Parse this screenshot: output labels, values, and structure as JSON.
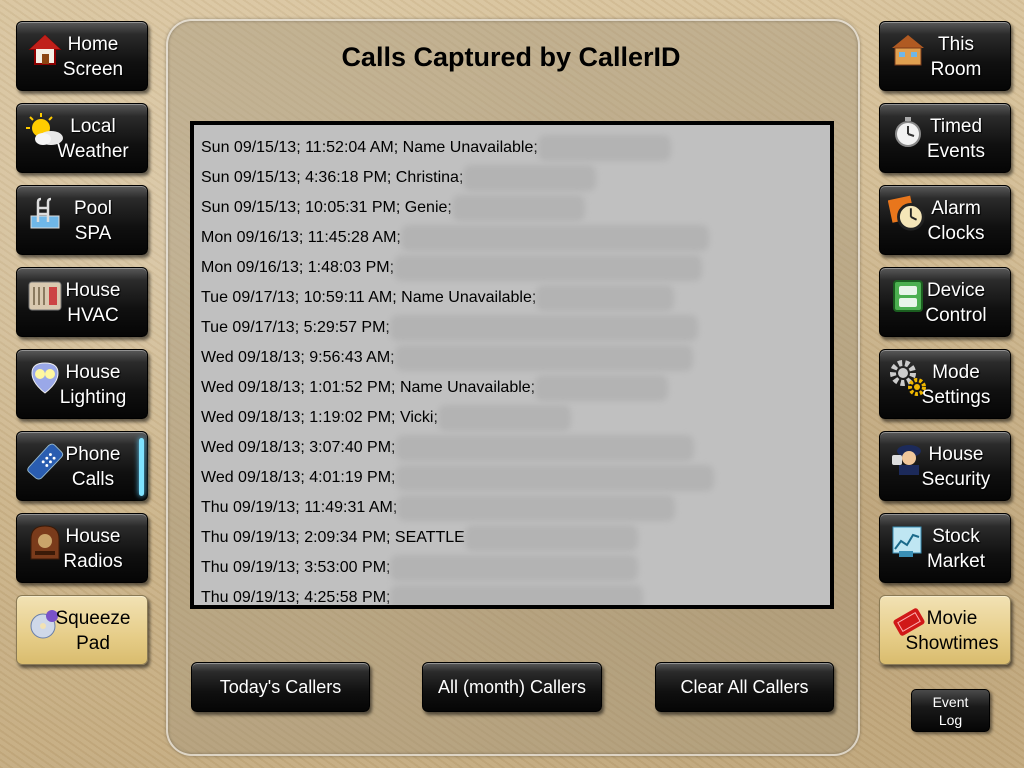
{
  "title": "Calls Captured by CallerID",
  "left_nav": [
    {
      "line1": "Home",
      "line2": "Screen",
      "icon": "house-icon"
    },
    {
      "line1": "Local",
      "line2": "Weather",
      "icon": "weather-icon"
    },
    {
      "line1": "Pool",
      "line2": "SPA",
      "icon": "pool-ladder-icon"
    },
    {
      "line1": "House",
      "line2": "HVAC",
      "icon": "hvac-unit-icon"
    },
    {
      "line1": "House",
      "line2": "Lighting",
      "icon": "lightbulb-icon"
    },
    {
      "line1": "Phone",
      "line2": "Calls",
      "icon": "telephone-icon",
      "active": true
    },
    {
      "line1": "House",
      "line2": "Radios",
      "icon": "radio-icon"
    },
    {
      "line1": "Squeeze",
      "line2": "Pad",
      "icon": "disc-icon"
    }
  ],
  "right_nav": [
    {
      "line1": "This",
      "line2": "Room",
      "icon": "room-house-icon"
    },
    {
      "line1": "Timed",
      "line2": "Events",
      "icon": "stopwatch-icon"
    },
    {
      "line1": "Alarm",
      "line2": "Clocks",
      "icon": "alarm-clock-icon"
    },
    {
      "line1": "Device",
      "line2": "Control",
      "icon": "outlet-icon"
    },
    {
      "line1": "Mode",
      "line2": "Settings",
      "icon": "gears-icon"
    },
    {
      "line1": "House",
      "line2": "Security",
      "icon": "security-guard-icon"
    },
    {
      "line1": "Stock",
      "line2": "Market",
      "icon": "stock-ticker-icon"
    },
    {
      "line1": "Movie",
      "line2": "Showtimes",
      "icon": "movie-ticket-icon"
    }
  ],
  "calls": [
    {
      "text": "Sun 09/15/13; 11:52:04 AM; Name Unavailable;"
    },
    {
      "text": "Sun 09/15/13; 4:36:18 PM; Christina;"
    },
    {
      "text": "Sun 09/15/13; 10:05:31 PM; Genie;"
    },
    {
      "text": "Mon 09/16/13; 11:45:28 AM;"
    },
    {
      "text": "Mon 09/16/13; 1:48:03 PM;"
    },
    {
      "text": "Tue 09/17/13; 10:59:11 AM; Name Unavailable;"
    },
    {
      "text": "Tue 09/17/13; 5:29:57 PM;"
    },
    {
      "text": "Wed 09/18/13; 9:56:43 AM;"
    },
    {
      "text": "Wed 09/18/13; 1:01:52 PM; Name Unavailable;"
    },
    {
      "text": "Wed 09/18/13; 1:19:02 PM; Vicki;"
    },
    {
      "text": "Wed 09/18/13; 3:07:40 PM;"
    },
    {
      "text": "Wed 09/18/13; 4:01:19 PM;"
    },
    {
      "text": "Thu 09/19/13; 11:49:31 AM;"
    },
    {
      "text": "Thu 09/19/13; 2:09:34 PM; SEATTLE"
    },
    {
      "text": "Thu 09/19/13; 3:53:00 PM;"
    },
    {
      "text": "Thu 09/19/13; 4:25:58 PM;"
    }
  ],
  "buttons": {
    "todays_callers": "Today's Callers",
    "all_month_callers": "All (month) Callers",
    "clear_all_callers": "Clear All Callers"
  },
  "event_log": {
    "line1": "Event",
    "line2": "Log"
  },
  "colors": {
    "active_indicator": "#7fe3ff",
    "list_background": "#c0c0c0"
  }
}
